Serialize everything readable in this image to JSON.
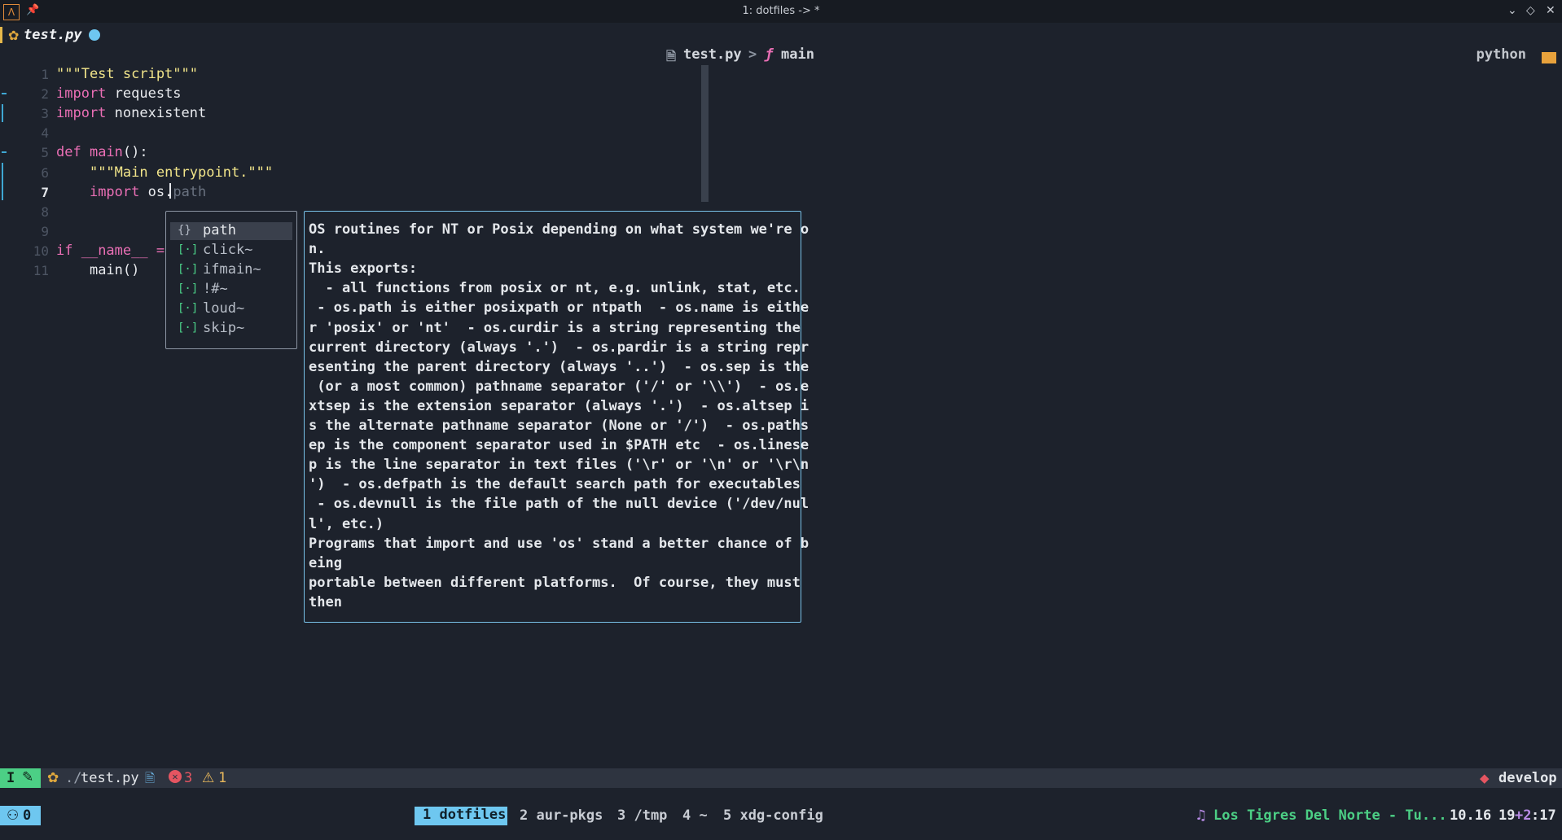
{
  "window": {
    "title": "1: dotfiles -> *",
    "controls": [
      "chevron-down",
      "diamond",
      "close"
    ]
  },
  "tab": {
    "filename": "test.py",
    "modified": true
  },
  "breadcrumb": {
    "file": "test.py",
    "separator": ">",
    "func_glyph": "ƒ",
    "symbol": "main"
  },
  "filetype": {
    "label": "python",
    "color": "#e8a23c"
  },
  "editor": {
    "lines": [
      {
        "n": "1",
        "code": [
          {
            "t": "\"\"\"Test script\"\"\"",
            "c": "str"
          }
        ]
      },
      {
        "n": "2",
        "code": [
          {
            "t": "import",
            "c": "kw"
          },
          {
            "t": " requests",
            "c": "txt"
          }
        ]
      },
      {
        "n": "3",
        "code": [
          {
            "t": "import",
            "c": "kw"
          },
          {
            "t": " nonexistent",
            "c": "txt"
          }
        ]
      },
      {
        "n": "4",
        "code": []
      },
      {
        "n": "5",
        "code": [
          {
            "t": "def",
            "c": "kw"
          },
          {
            "t": " main",
            "c": "kw"
          },
          {
            "t": "():",
            "c": "txt"
          }
        ]
      },
      {
        "n": "6",
        "code": [
          {
            "t": "    ",
            "c": "txt"
          },
          {
            "t": "\"\"\"Main entrypoint.\"\"\"",
            "c": "str"
          }
        ]
      },
      {
        "n": "7",
        "code": [
          {
            "t": "    ",
            "c": "txt"
          },
          {
            "t": "import",
            "c": "kw"
          },
          {
            "t": " os.",
            "c": "txt"
          },
          {
            "t": "path",
            "c": "ghost"
          }
        ]
      },
      {
        "n": "8",
        "code": []
      },
      {
        "n": "9",
        "code": []
      },
      {
        "n": "10",
        "code": [
          {
            "t": "if",
            "c": "kw"
          },
          {
            "t": " __name__",
            "c": "kw"
          },
          {
            "t": " =",
            "c": "kw"
          }
        ]
      },
      {
        "n": "11",
        "code": [
          {
            "t": "    ",
            "c": "txt"
          },
          {
            "t": "main",
            "c": "txt"
          },
          {
            "t": "()",
            "c": "txt"
          }
        ]
      }
    ],
    "current_line": "7"
  },
  "completion": {
    "items": [
      {
        "icon": "{}",
        "label": "path",
        "selected": true
      },
      {
        "icon": "[·]",
        "label": "click~"
      },
      {
        "icon": "[·]",
        "label": "ifmain~"
      },
      {
        "icon": "[·]",
        "label": "!#~"
      },
      {
        "icon": "[·]",
        "label": "loud~"
      },
      {
        "icon": "[·]",
        "label": "skip~"
      }
    ]
  },
  "doc": {
    "lines": [
      "OS routines for NT or Posix depending on what system we're o",
      "n.",
      "This exports:",
      "  - all functions from posix or nt, e.g. unlink, stat, etc.",
      " - os.path is either posixpath or ntpath  - os.name is eithe",
      "r 'posix' or 'nt'  - os.curdir is a string representing the",
      "current directory (always '.')  - os.pardir is a string repr",
      "esenting the parent directory (always '..')  - os.sep is the",
      " (or a most common) pathname separator ('/' or '\\\\')  - os.e",
      "xtsep is the extension separator (always '.')  - os.altsep i",
      "s the alternate pathname separator (None or '/')  - os.paths",
      "ep is the component separator used in $PATH etc  - os.linese",
      "p is the line separator in text files ('\\r' or '\\n' or '\\r\\n",
      "')  - os.defpath is the default search path for executables",
      " - os.devnull is the file path of the null device ('/dev/nul",
      "l', etc.)",
      "Programs that import and use 'os' stand a better chance of b",
      "eing",
      "portable between different platforms.  Of course, they must",
      "then"
    ]
  },
  "statusline": {
    "mode": "I",
    "path_prefix": "./",
    "path_name": "test.py",
    "errors": "3",
    "warnings": "1",
    "branch": "develop"
  },
  "tmux": {
    "session_count": "0",
    "windows": [
      {
        "label": "1 dotfiles",
        "active": true
      },
      {
        "label": "2 aur-pkgs"
      },
      {
        "label": "3 /tmp"
      },
      {
        "label": "4 ~"
      },
      {
        "label": "5 xdg-config"
      }
    ],
    "now_playing": "Los Tigres Del Norte - Tu...",
    "date": "10.16",
    "time_h": "19",
    "time_offset": "+2",
    "time_m": ":17"
  }
}
